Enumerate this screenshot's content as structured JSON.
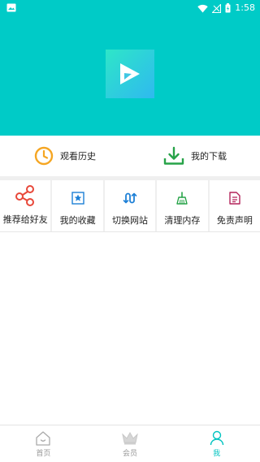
{
  "status_bar": {
    "time": "1:58",
    "icons": [
      "image-icon",
      "wifi-icon",
      "signal-off-icon",
      "battery-charging-icon"
    ]
  },
  "colors": {
    "header_bg": "#00cbc7",
    "accent": "#00c3c0",
    "history_icon": "#f5a623",
    "download_icon": "#27a348"
  },
  "quick_actions": [
    {
      "label": "观看历史",
      "icon": "clock-icon"
    },
    {
      "label": "我的下载",
      "icon": "download-icon"
    }
  ],
  "grid": [
    {
      "label": "推荐给好友",
      "icon": "share-icon"
    },
    {
      "label": "我的收藏",
      "icon": "favorite-icon"
    },
    {
      "label": "切换网站",
      "icon": "switch-icon"
    },
    {
      "label": "清理内存",
      "icon": "broom-icon"
    },
    {
      "label": "免责声明",
      "icon": "document-icon"
    }
  ],
  "tabbar": {
    "active": "我",
    "tabs": [
      {
        "label": "首页",
        "icon": "home-icon"
      },
      {
        "label": "会员",
        "icon": "crown-icon"
      },
      {
        "label": "我",
        "icon": "person-icon"
      }
    ]
  }
}
